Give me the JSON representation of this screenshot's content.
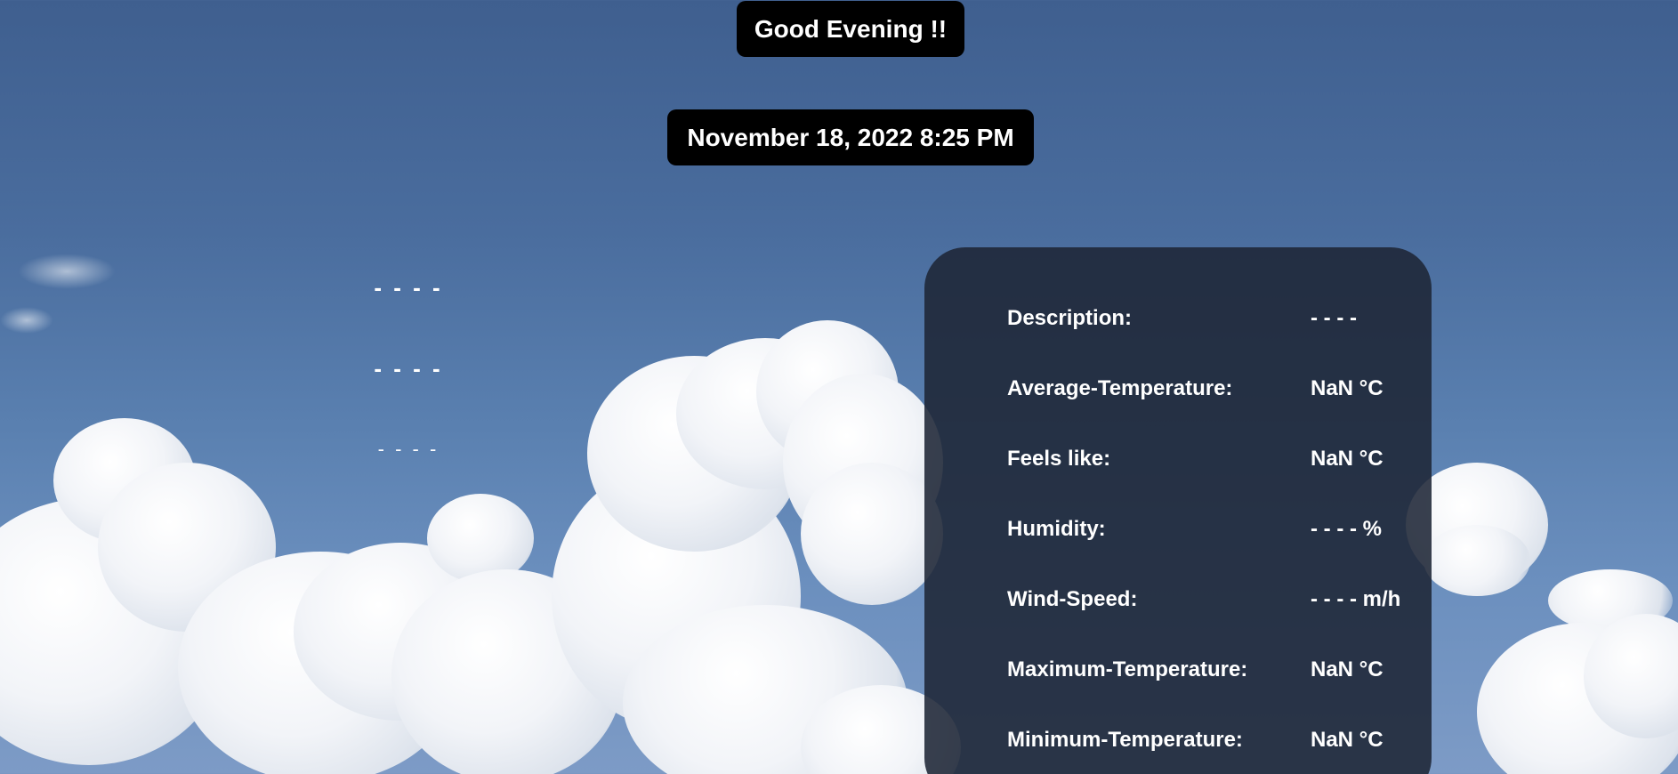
{
  "header": {
    "greeting": "Good Evening !!",
    "datetime": "November 18, 2022 8:25 PM"
  },
  "left_placeholders": [
    "- - - -",
    "- - - -",
    "- - - -"
  ],
  "weather_details": [
    {
      "label": "Description:",
      "value": "- - - -"
    },
    {
      "label": "Average-Temperature:",
      "value": "NaN °C"
    },
    {
      "label": "Feels like:",
      "value": "NaN °C"
    },
    {
      "label": "Humidity:",
      "value": "- - - - %"
    },
    {
      "label": "Wind-Speed:",
      "value": "- - - - m/h"
    },
    {
      "label": "Maximum-Temperature:",
      "value": "NaN °C"
    },
    {
      "label": "Minimum-Temperature:",
      "value": "NaN °C"
    }
  ],
  "colors": {
    "sky": "#4a6d9e",
    "panel": "#1e2636",
    "pill": "#000000",
    "text": "#ffffff"
  }
}
